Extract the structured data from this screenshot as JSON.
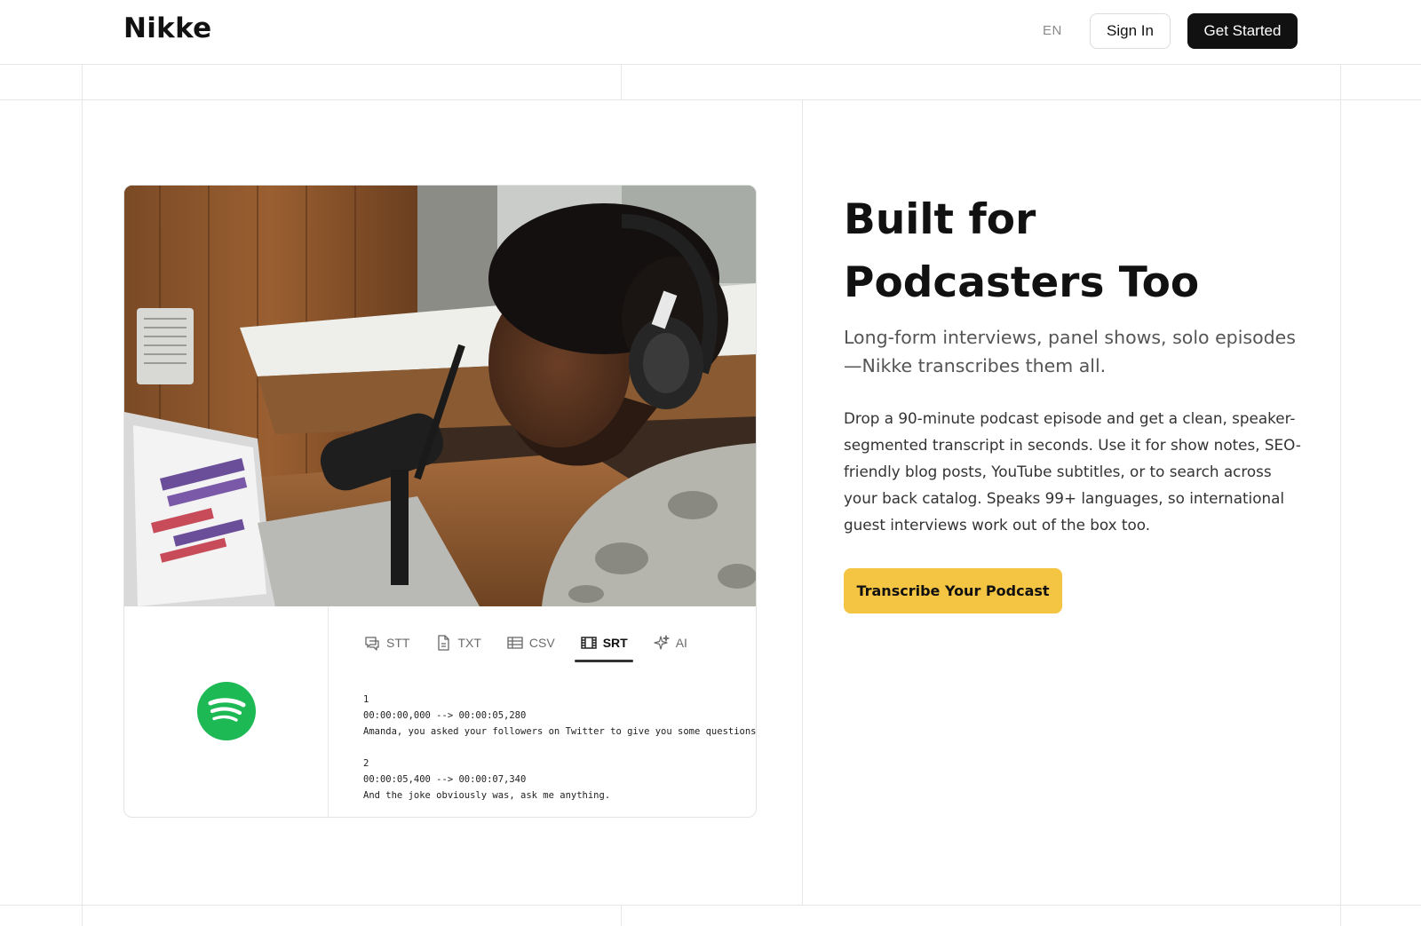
{
  "header": {
    "logo": "Nikke",
    "language": "EN",
    "sign_in": "Sign In",
    "get_started": "Get Started"
  },
  "hero": {
    "headline_line1": "Built for",
    "headline_line2": "Podcasters Too",
    "subheadline": "Long-form interviews, panel shows, solo episodes—Nikke transcribes them all.",
    "body": "Drop a 90-minute podcast episode and get a clean, speaker-segmented transcript in seconds. Use it for show notes, SEO-friendly blog posts, YouTube subtitles, or to search across your back catalog. Speaks 99+ languages, so international guest interviews work out of the box too.",
    "cta": "Transcribe Your Podcast"
  },
  "card": {
    "tabs": [
      {
        "label": "STT",
        "icon": "speech-bubble-icon"
      },
      {
        "label": "TXT",
        "icon": "document-icon"
      },
      {
        "label": "CSV",
        "icon": "table-icon"
      },
      {
        "label": "SRT",
        "icon": "film-icon",
        "active": true
      },
      {
        "label": "AI",
        "icon": "sparkles-icon"
      }
    ],
    "srt_lines": [
      "1",
      "00:00:00,000 --> 00:00:05,280",
      "Amanda, you asked your followers on Twitter to give you some questions, to",
      "",
      "2",
      "00:00:05,400 --> 00:00:07,340",
      "And the joke obviously was, ask me anything."
    ],
    "brand_logo": "spotify-logo-icon"
  },
  "colors": {
    "cta_bg": "#f4c542",
    "primary_button_bg": "#111111",
    "spotify_green": "#1db954"
  }
}
